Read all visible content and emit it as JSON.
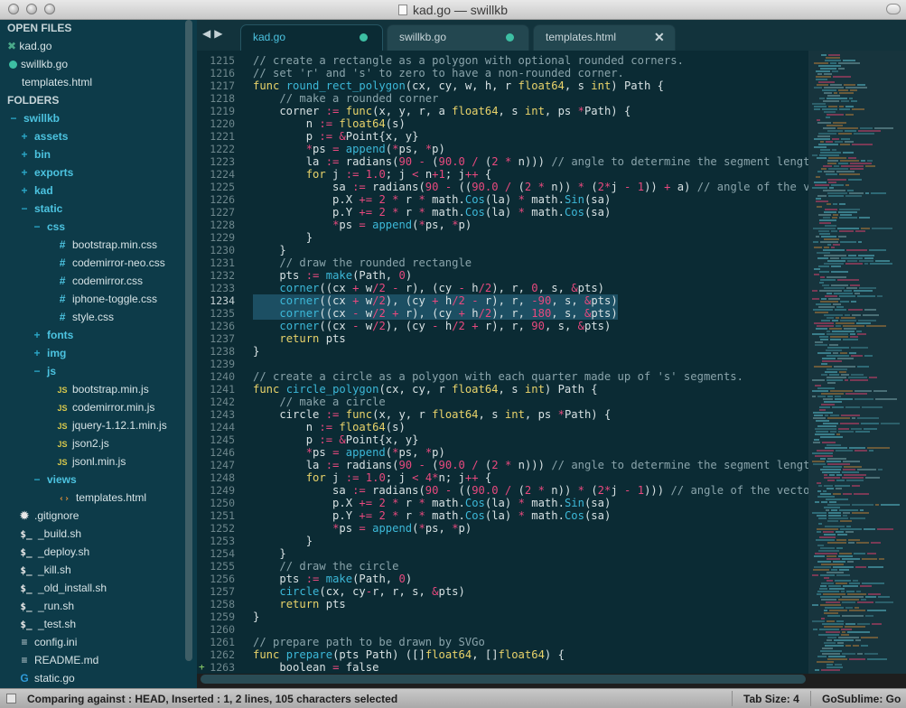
{
  "window": {
    "title": "kad.go — swillkb"
  },
  "sidebar": {
    "open_files_header": "OPEN FILES",
    "open_files": [
      {
        "label": "kad.go",
        "marker": "close"
      },
      {
        "label": "swillkb.go",
        "marker": "dot"
      },
      {
        "label": "templates.html",
        "marker": "none"
      }
    ],
    "folders_header": "FOLDERS",
    "tree": [
      {
        "label": "swillkb",
        "icon": "minus",
        "depth": 0
      },
      {
        "label": "assets",
        "icon": "plus",
        "depth": 1
      },
      {
        "label": "bin",
        "icon": "plus",
        "depth": 1
      },
      {
        "label": "exports",
        "icon": "plus",
        "depth": 1
      },
      {
        "label": "kad",
        "icon": "plus",
        "depth": 1
      },
      {
        "label": "static",
        "icon": "minus",
        "depth": 1
      },
      {
        "label": "css",
        "icon": "minus",
        "depth": 2
      },
      {
        "label": "bootstrap.min.css",
        "icon": "hash",
        "depth": 3
      },
      {
        "label": "codemirror-neo.css",
        "icon": "hash",
        "depth": 3
      },
      {
        "label": "codemirror.css",
        "icon": "hash",
        "depth": 3
      },
      {
        "label": "iphone-toggle.css",
        "icon": "hash",
        "depth": 3
      },
      {
        "label": "style.css",
        "icon": "hash",
        "depth": 3
      },
      {
        "label": "fonts",
        "icon": "plus",
        "depth": 2
      },
      {
        "label": "img",
        "icon": "plus",
        "depth": 2
      },
      {
        "label": "js",
        "icon": "minus",
        "depth": 2
      },
      {
        "label": "bootstrap.min.js",
        "icon": "js",
        "depth": 3
      },
      {
        "label": "codemirror.min.js",
        "icon": "js",
        "depth": 3
      },
      {
        "label": "jquery-1.12.1.min.js",
        "icon": "js",
        "depth": 3
      },
      {
        "label": "json2.js",
        "icon": "js",
        "depth": 3
      },
      {
        "label": "jsonl.min.js",
        "icon": "js",
        "depth": 3
      },
      {
        "label": "views",
        "icon": "minus",
        "depth": 2
      },
      {
        "label": "templates.html",
        "icon": "tag",
        "depth": 3
      },
      {
        "label": ".gitignore",
        "icon": "gear",
        "depth": 1
      },
      {
        "label": "_build.sh",
        "icon": "dollar",
        "depth": 1
      },
      {
        "label": "_deploy.sh",
        "icon": "dollar",
        "depth": 1
      },
      {
        "label": "_kill.sh",
        "icon": "dollar",
        "depth": 1
      },
      {
        "label": "_old_install.sh",
        "icon": "dollar",
        "depth": 1
      },
      {
        "label": "_run.sh",
        "icon": "dollar",
        "depth": 1
      },
      {
        "label": "_test.sh",
        "icon": "dollar",
        "depth": 1
      },
      {
        "label": "config.ini",
        "icon": "lines",
        "depth": 1
      },
      {
        "label": "README.md",
        "icon": "lines",
        "depth": 1
      },
      {
        "label": "static.go",
        "icon": "go",
        "depth": 1
      }
    ]
  },
  "tabs": [
    {
      "label": "kad.go",
      "active": true,
      "marker": "dot"
    },
    {
      "label": "swillkb.go",
      "active": false,
      "marker": "dot"
    },
    {
      "label": "templates.html",
      "active": false,
      "marker": "close"
    }
  ],
  "editor": {
    "first_line": 1215,
    "current_line": 1234,
    "added_line": 1263,
    "selected_lines": [
      1234,
      1235
    ],
    "lines": [
      "// create a rectangle as a polygon with optional rounded corners.",
      "// set 'r' and 's' to zero to have a non-rounded corner.",
      "func round_rect_polygon(cx, cy, w, h, r float64, s int) Path {",
      "    // make a rounded corner",
      "    corner := func(x, y, r, a float64, s int, ps *Path) {",
      "        n := float64(s)",
      "        p := &Point{x, y}",
      "        *ps = append(*ps, *p)",
      "        la := radians(90 - (90.0 / (2 * n))) // angle to determine the segment length",
      "        for j := 1.0; j < n+1; j++ {",
      "            sa := radians(90 - ((90.0 / (2 * n)) * (2*j - 1)) + a) // angle of the vector",
      "            p.X += 2 * r * math.Cos(la) * math.Sin(sa)",
      "            p.Y += 2 * r * math.Cos(la) * math.Cos(sa)",
      "            *ps = append(*ps, *p)",
      "        }",
      "    }",
      "    // draw the rounded rectangle",
      "    pts := make(Path, 0)",
      "    corner((cx + w/2 - r), (cy - h/2), r, 0, s, &pts)",
      "    corner((cx + w/2), (cy + h/2 - r), r, -90, s, &pts)",
      "    corner((cx - w/2 + r), (cy + h/2), r, 180, s, &pts)",
      "    corner((cx - w/2), (cy - h/2 + r), r, 90, s, &pts)",
      "    return pts",
      "}",
      "",
      "// create a circle as a polygon with each quarter made up of 's' segments.",
      "func circle_polygon(cx, cy, r float64, s int) Path {",
      "    // make a circle",
      "    circle := func(x, y, r float64, s int, ps *Path) {",
      "        n := float64(s)",
      "        p := &Point{x, y}",
      "        *ps = append(*ps, *p)",
      "        la := radians(90 - (90.0 / (2 * n))) // angle to determine the segment length",
      "        for j := 1.0; j < 4*n; j++ {",
      "            sa := radians(90 - ((90.0 / (2 * n)) * (2*j - 1))) // angle of the vector of",
      "            p.X += 2 * r * math.Cos(la) * math.Sin(sa)",
      "            p.Y += 2 * r * math.Cos(la) * math.Cos(sa)",
      "            *ps = append(*ps, *p)",
      "        }",
      "    }",
      "    // draw the circle",
      "    pts := make(Path, 0)",
      "    circle(cx, cy-r, r, s, &pts)",
      "    return pts",
      "}",
      "",
      "// prepare path to be drawn by SVGo",
      "func prepare(pts Path) ([]float64, []float64) {",
      "    boolean = false"
    ]
  },
  "statusbar": {
    "left": "Comparing against : HEAD, Inserted : 1, 2 lines, 105 characters selected",
    "tab_size": "Tab Size: 4",
    "syntax": "GoSublime: Go"
  },
  "colors": {
    "sidebar_bg": "#0d3b49",
    "editor_bg": "#0b2b34",
    "accent": "#4cc3e0",
    "keyword": "#e9d36a",
    "function": "#3cb8d8",
    "operator": "#e8497e",
    "comment": "#8aa4ab"
  }
}
